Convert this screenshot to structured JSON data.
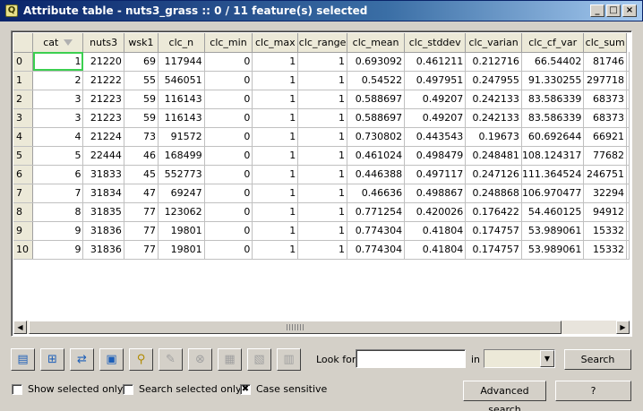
{
  "window": {
    "title": "Attribute table - nuts3_grass :: 0 / 11 feature(s) selected",
    "app_icon": "Q",
    "buttons": [
      "_",
      "□",
      "×"
    ]
  },
  "table": {
    "columns": [
      "cat",
      "nuts3",
      "wsk1",
      "clc_n",
      "clc_min",
      "clc_max",
      "clc_range",
      "clc_mean",
      "clc_stddev",
      "clc_varian",
      "clc_cf_var",
      "clc_sum"
    ],
    "rows": [
      {
        "id": "0",
        "cells": [
          "1",
          "21220",
          "69",
          "117944",
          "0",
          "1",
          "1",
          "0.693092",
          "0.461211",
          "0.212716",
          "66.54402",
          "81746"
        ]
      },
      {
        "id": "1",
        "cells": [
          "2",
          "21222",
          "55",
          "546051",
          "0",
          "1",
          "1",
          "0.54522",
          "0.497951",
          "0.247955",
          "91.330255",
          "297718"
        ]
      },
      {
        "id": "2",
        "cells": [
          "3",
          "21223",
          "59",
          "116143",
          "0",
          "1",
          "1",
          "0.588697",
          "0.49207",
          "0.242133",
          "83.586339",
          "68373"
        ]
      },
      {
        "id": "3",
        "cells": [
          "3",
          "21223",
          "59",
          "116143",
          "0",
          "1",
          "1",
          "0.588697",
          "0.49207",
          "0.242133",
          "83.586339",
          "68373"
        ]
      },
      {
        "id": "4",
        "cells": [
          "4",
          "21224",
          "73",
          "91572",
          "0",
          "1",
          "1",
          "0.730802",
          "0.443543",
          "0.19673",
          "60.692644",
          "66921"
        ]
      },
      {
        "id": "5",
        "cells": [
          "5",
          "22444",
          "46",
          "168499",
          "0",
          "1",
          "1",
          "0.461024",
          "0.498479",
          "0.248481",
          "108.124317",
          "77682"
        ]
      },
      {
        "id": "6",
        "cells": [
          "6",
          "31833",
          "45",
          "552773",
          "0",
          "1",
          "1",
          "0.446388",
          "0.497117",
          "0.247126",
          "111.364524",
          "246751"
        ]
      },
      {
        "id": "7",
        "cells": [
          "7",
          "31834",
          "47",
          "69247",
          "0",
          "1",
          "1",
          "0.46636",
          "0.498867",
          "0.248868",
          "106.970477",
          "32294"
        ]
      },
      {
        "id": "8",
        "cells": [
          "8",
          "31835",
          "77",
          "123062",
          "0",
          "1",
          "1",
          "0.771254",
          "0.420026",
          "0.176422",
          "54.460125",
          "94912"
        ]
      },
      {
        "id": "9",
        "cells": [
          "9",
          "31836",
          "77",
          "19801",
          "0",
          "1",
          "1",
          "0.774304",
          "0.41804",
          "0.174757",
          "53.989061",
          "15332"
        ]
      },
      {
        "id": "10",
        "cells": [
          "9",
          "31836",
          "77",
          "19801",
          "0",
          "1",
          "1",
          "0.774304",
          "0.41804",
          "0.174757",
          "53.989061",
          "15332"
        ]
      }
    ]
  },
  "toolbar": {
    "icons": [
      "table-select-icon",
      "zoom-to-selection-icon",
      "invert-selection-icon",
      "move-selection-to-top-icon",
      "search-icon",
      "edit-pencil-icon",
      "delete-icon",
      "new-column-icon",
      "delete-column-icon",
      "calculator-icon"
    ]
  },
  "search": {
    "look_for_label": "Look for",
    "look_for_value": "",
    "in_label": "in",
    "in_value": "",
    "search_button": "Search",
    "advanced_button": "Advanced search",
    "help_button": "?"
  },
  "options": {
    "show_selected_only": {
      "label": "Show selected only",
      "checked": false
    },
    "search_selected_only": {
      "label": "Search selected only",
      "checked": false
    },
    "case_sensitive": {
      "label": "Case sensitive",
      "checked": true,
      "mark": "✖"
    }
  }
}
